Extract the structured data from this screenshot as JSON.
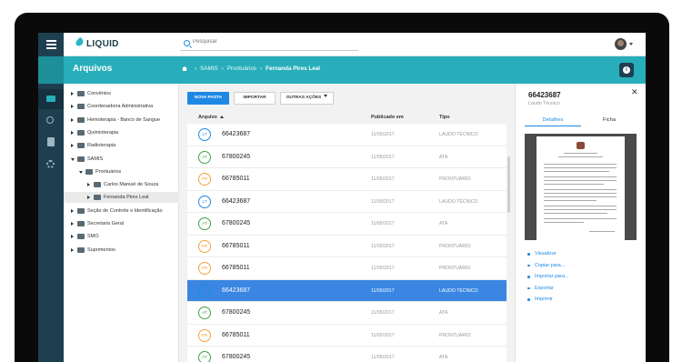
{
  "app": {
    "logo_text": "LIQUID"
  },
  "search": {
    "placeholder": "Pesquisar"
  },
  "header": {
    "title": "Arquivos",
    "breadcrumb": [
      "SAMIS",
      "Prontuários",
      "Fernanda Pires Leal"
    ]
  },
  "tree": [
    {
      "label": "Convênios",
      "level": 0,
      "state": "closed"
    },
    {
      "label": "Coordenadoria Administrativa",
      "level": 0,
      "state": "closed"
    },
    {
      "label": "Hemoterapia - Banco de Sangue",
      "level": 0,
      "state": "closed"
    },
    {
      "label": "Quimioterapia",
      "level": 0,
      "state": "closed"
    },
    {
      "label": "Radioterapia",
      "level": 0,
      "state": "closed"
    },
    {
      "label": "SAMIS",
      "level": 0,
      "state": "open"
    },
    {
      "label": "Prontuários",
      "level": 1,
      "state": "open"
    },
    {
      "label": "Carlos Manuel de Souza",
      "level": 2,
      "state": "closed"
    },
    {
      "label": "Fernanda Pires Leal",
      "level": 2,
      "state": "closed",
      "selected": true
    },
    {
      "label": "Seção de Controle e Identificação",
      "level": 0,
      "state": "closed"
    },
    {
      "label": "Secretaria Geral",
      "level": 0,
      "state": "closed"
    },
    {
      "label": "SMO",
      "level": 0,
      "state": "closed"
    },
    {
      "label": "Suprimentos",
      "level": 0,
      "state": "closed"
    }
  ],
  "toolbar": {
    "new_folder": "NOVA PASTA",
    "import": "IMPORTAR",
    "more_actions": "OUTRAS AÇÕES"
  },
  "table": {
    "headers": {
      "name": "Arquivo",
      "date": "Publicado em",
      "type": "Tipo"
    },
    "rows": [
      {
        "badge": "LT",
        "badge_color": "#1e88e5",
        "name": "66423687",
        "date": "11/05/2017",
        "type": "LAUDO TÉCNICO"
      },
      {
        "badge": "AT",
        "badge_color": "#43a047",
        "name": "67800245",
        "date": "11/05/2017",
        "type": "ATA"
      },
      {
        "badge": "PR",
        "badge_color": "#f5a13a",
        "name": "66785011",
        "date": "11/05/2017",
        "type": "PRONTUÁRIO"
      },
      {
        "badge": "LT",
        "badge_color": "#1e88e5",
        "name": "66423687",
        "date": "11/05/2017",
        "type": "LAUDO TÉCNICO"
      },
      {
        "badge": "AT",
        "badge_color": "#43a047",
        "name": "67800245",
        "date": "11/05/2017",
        "type": "ATA"
      },
      {
        "badge": "PR",
        "badge_color": "#f5a13a",
        "name": "66785011",
        "date": "11/05/2017",
        "type": "PRONTUÁRIO"
      },
      {
        "badge": "PR",
        "badge_color": "#f5a13a",
        "name": "66785011",
        "date": "11/05/2017",
        "type": "PRONTUÁRIO"
      },
      {
        "badge": "LT",
        "badge_color": "#1e88e5",
        "name": "66423687",
        "date": "11/05/2017",
        "type": "LAUDO TÉCNICO",
        "selected": true
      },
      {
        "badge": "AT",
        "badge_color": "#43a047",
        "name": "67800245",
        "date": "11/05/2017",
        "type": "ATA"
      },
      {
        "badge": "PR",
        "badge_color": "#f5a13a",
        "name": "66785011",
        "date": "11/05/2017",
        "type": "PRONTUÁRIO"
      },
      {
        "badge": "AT",
        "badge_color": "#43a047",
        "name": "67800245",
        "date": "11/05/2017",
        "type": "ATA"
      }
    ]
  },
  "details": {
    "title": "66423687",
    "subtitle": "Laudo Técnico",
    "tabs": [
      "Detalhes",
      "Ficha"
    ],
    "actions": [
      "Visualizar",
      "Copiar para...",
      "Importar para...",
      "Exportar",
      "Imprimir"
    ]
  },
  "colors": {
    "accent": "#1e88e5",
    "teal": "#27aeba",
    "navy": "#1e3f50",
    "selected_row": "#3a86e2"
  }
}
